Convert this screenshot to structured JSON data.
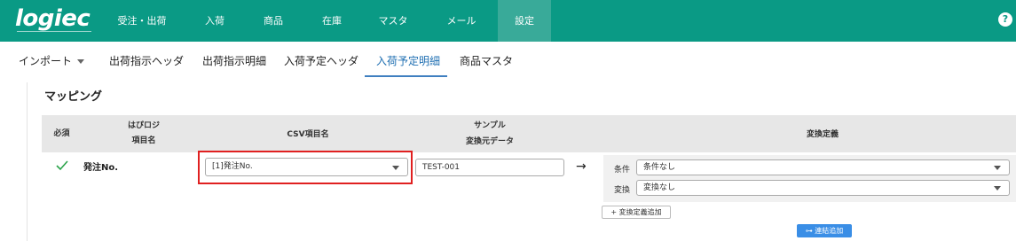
{
  "logo": {
    "text": "logiec"
  },
  "nav": {
    "items": [
      {
        "label": "受注・出荷"
      },
      {
        "label": "入荷"
      },
      {
        "label": "商品"
      },
      {
        "label": "在庫"
      },
      {
        "label": "マスタ"
      },
      {
        "label": "メール"
      },
      {
        "label": "設定",
        "active": true
      }
    ],
    "help": "?"
  },
  "subtabs": {
    "import_label": "インポート",
    "items": [
      {
        "label": "出荷指示ヘッダ"
      },
      {
        "label": "出荷指示明細"
      },
      {
        "label": "入荷予定ヘッダ"
      },
      {
        "label": "入荷予定明細",
        "active": true
      },
      {
        "label": "商品マスタ"
      }
    ]
  },
  "section": {
    "title": "マッピング"
  },
  "table": {
    "headers": {
      "required": "必須",
      "hapi_line1": "はぴロジ",
      "hapi_line2": "項目名",
      "csv": "CSV項目名",
      "sample_line1": "サンプル",
      "sample_line2": "変換元データ",
      "conversion": "変換定義"
    },
    "rows": [
      {
        "field": "発注No.",
        "csv_value": "[1]発注No.",
        "sample": "TEST-001",
        "condition_label": "条件",
        "condition_value": "条件なし",
        "transform_label": "変換",
        "transform_value": "変換なし"
      }
    ]
  },
  "buttons": {
    "add_conversion": "+ 変換定義追加",
    "add_join": "⊶ 連結追加"
  },
  "colors": {
    "brand": "#0a9a85",
    "active_tab": "#1f6fb2",
    "highlight": "#e02020",
    "primary_button": "#3a8ee6"
  }
}
